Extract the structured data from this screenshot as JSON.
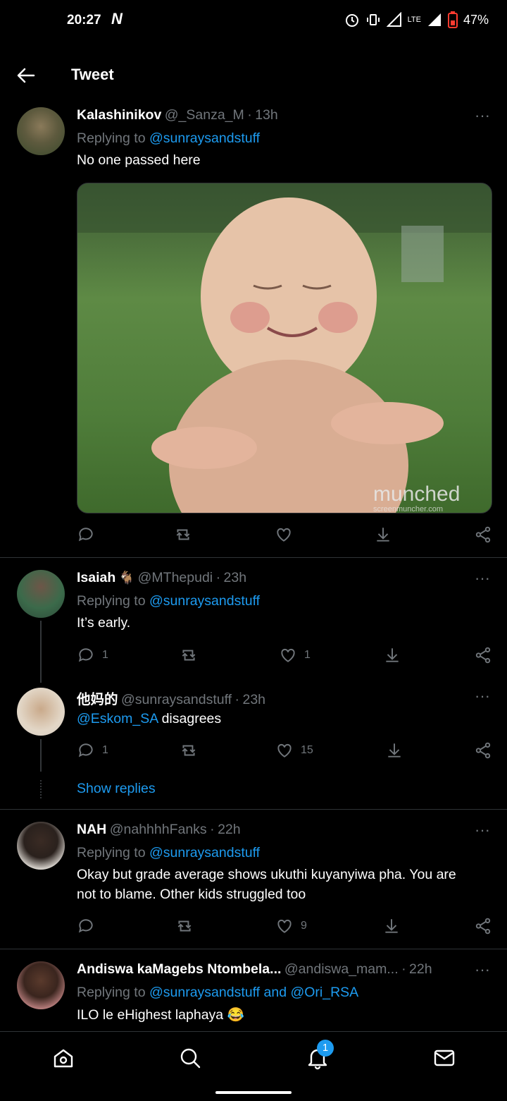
{
  "status_bar": {
    "time": "20:27",
    "network_logo": "N",
    "lte": "LTE",
    "battery": "47%"
  },
  "header": {
    "title": "Tweet"
  },
  "tweets": [
    {
      "name": "Kalashinikov",
      "handle": "@_Sanza_M",
      "time": "13h",
      "reply_prefix": "Replying to ",
      "reply_to": "@sunraysandstuff",
      "text": "No one passed here",
      "image_watermark": "munched",
      "image_watermark_sub": "screenmuncher.com",
      "replies": "",
      "retweets": "",
      "likes": ""
    },
    {
      "name": "Isaiah",
      "handle": "@MThepudi",
      "time": "23h",
      "reply_prefix": "Replying to ",
      "reply_to": "@sunraysandstuff",
      "text": "It’s early.",
      "replies": "1",
      "retweets": "",
      "likes": "1"
    },
    {
      "name": "他妈的",
      "handle": "@sunraysandstuff",
      "time": "23h",
      "mention": "@Eskom_SA",
      "text": " disagrees",
      "replies": "1",
      "retweets": "",
      "likes": "15",
      "show_replies": "Show replies"
    },
    {
      "name": "NAH",
      "handle": "@nahhhhFanks",
      "time": "22h",
      "reply_prefix": "Replying to ",
      "reply_to": "@sunraysandstuff",
      "text_line1": "Okay but grade average shows ukuthi kuyanyiwa pha. You are",
      "text_line2": "not to blame. Other kids struggled too",
      "replies": "",
      "retweets": "",
      "likes": "9"
    },
    {
      "name": "Andiswa kaMagebs Ntombela...",
      "handle": "@andiswa_mam...",
      "time": "22h",
      "reply_prefix": "Replying to ",
      "reply_to": "@sunraysandstuff and @Ori_RSA",
      "text": "ILO le eHighest laphaya",
      "emoji": "😂"
    }
  ],
  "bottom_nav": {
    "notification_count": "1"
  },
  "colors": {
    "accent": "#1d9bf0",
    "muted": "#71767b",
    "divider": "#2f3336"
  }
}
